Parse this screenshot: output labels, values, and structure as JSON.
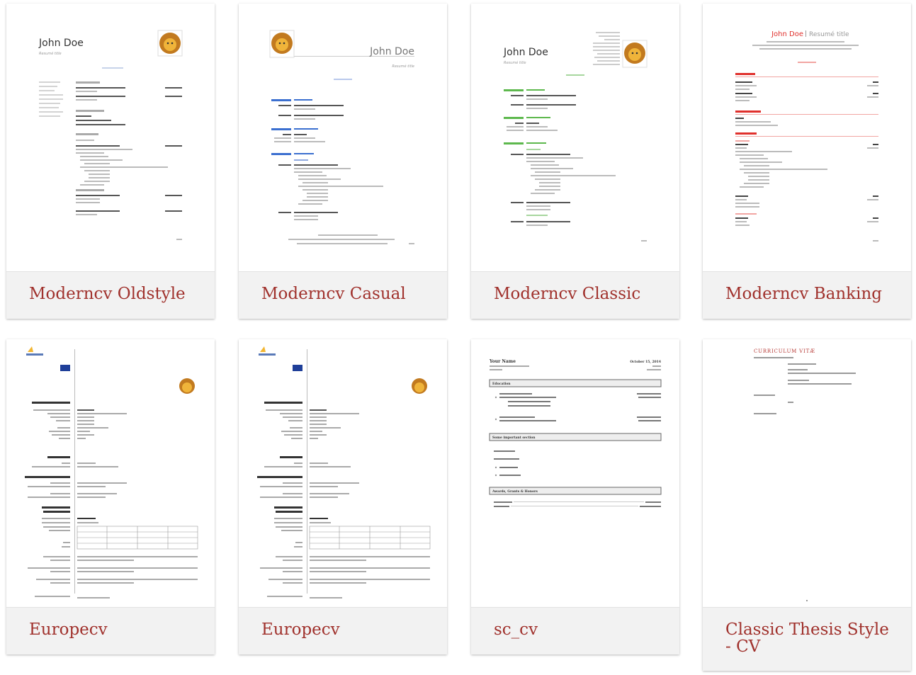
{
  "templates": [
    {
      "title": "Moderncv Oldstyle"
    },
    {
      "title": "Moderncv Casual"
    },
    {
      "title": "Moderncv Classic"
    },
    {
      "title": "Moderncv Banking"
    },
    {
      "title": "Europecv"
    },
    {
      "title": "Europecv"
    },
    {
      "title": "sc_cv"
    },
    {
      "title": "Classic Thesis Style - CV"
    }
  ],
  "previews": {
    "cv_name": "John Doe",
    "resume_title": "Resumé title",
    "banking_name_title": "Resumé title",
    "thesis_heading": "CURRICULUM VITÆ",
    "sc_name": "Your Name",
    "sc_date": "October 15, 2014",
    "sc_sections": [
      "Education",
      "Some important section",
      "Awards, Grants & Honors"
    ]
  },
  "colors": {
    "card_bg": "#f2f2f2",
    "title": "#a0312c",
    "casual_accent": "#3b6fd0",
    "classic_accent": "#5db84d",
    "banking_accent": "#e0302c"
  }
}
